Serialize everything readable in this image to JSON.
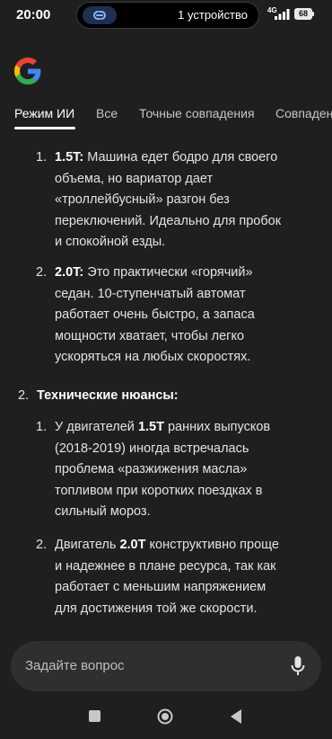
{
  "status_bar": {
    "time": "20:00",
    "devices": "1 устройство",
    "network": "4G",
    "battery": "68"
  },
  "tabs": [
    {
      "label": "Режим ИИ",
      "active": true
    },
    {
      "label": "Все",
      "active": false
    },
    {
      "label": "Точные совпадения",
      "active": false
    },
    {
      "label": "Совпаден",
      "active": false
    }
  ],
  "content": {
    "sub1": [
      {
        "num": "1.",
        "lines": [
          {
            "bold": "1.5T:",
            "rest": " Машина едет бодро для своего"
          },
          {
            "text": "объема, но вариатор дает"
          },
          {
            "text": "«троллейбусный» разгон без"
          },
          {
            "text": "переключений. Идеально для пробок"
          },
          {
            "text": "и спокойной езды."
          }
        ]
      },
      {
        "num": "2.",
        "lines": [
          {
            "bold": "2.0T:",
            "rest": " Это практически «горячий»"
          },
          {
            "text": "седан. 10-ступенчатый автомат"
          },
          {
            "text": "работает очень быстро, а запаса"
          },
          {
            "text": "мощности хватает, чтобы легко"
          },
          {
            "text": "ускоряться на любых скоростях."
          }
        ]
      }
    ],
    "section2": {
      "num": "2.",
      "title": "Технические нюансы:"
    },
    "sub2": [
      {
        "num": "1.",
        "lines": [
          {
            "pre": "У двигателей ",
            "bold": "1.5T",
            "rest": " ранних выпусков"
          },
          {
            "text": "(2018-2019) иногда встречалась"
          },
          {
            "text": "проблема «разжижения масла»"
          },
          {
            "text": "топливом при коротких поездках в"
          },
          {
            "text": "сильный мороз."
          }
        ]
      },
      {
        "num": "2.",
        "lines": [
          {
            "pre": "Двигатель ",
            "bold": "2.0T",
            "rest": " конструктивно проще"
          },
          {
            "text": "и надежнее в плане ресурса, так как"
          },
          {
            "text": "работает с меньшим напряжением"
          },
          {
            "text": "для достижения той же скорости."
          }
        ]
      }
    ]
  },
  "ask_bar": {
    "placeholder": "Задайте вопрос"
  },
  "icons": {
    "link": "link-icon",
    "mic": "mic-icon",
    "google": "google-logo",
    "nav_recent": "recent-apps-icon",
    "nav_home": "home-icon",
    "nav_back": "back-icon"
  }
}
